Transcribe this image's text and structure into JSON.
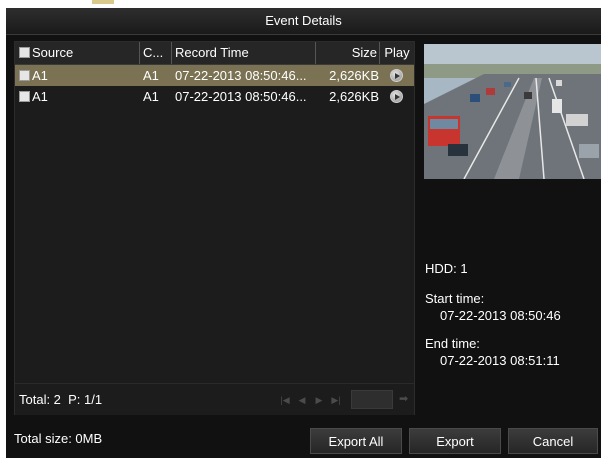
{
  "dialog": {
    "title": "Event Details"
  },
  "table": {
    "headers": {
      "source": "Source",
      "channel": "C...",
      "record_time": "Record Time",
      "size": "Size",
      "play": "Play"
    },
    "rows": [
      {
        "source": "A1",
        "channel": "A1",
        "record_time": "07-22-2013 08:50:46...",
        "size": "2,626KB",
        "selected": true
      },
      {
        "source": "A1",
        "channel": "A1",
        "record_time": "07-22-2013 08:50:46...",
        "size": "2,626KB",
        "selected": false
      }
    ]
  },
  "pager": {
    "summary": "Total: 2  P: 1/1"
  },
  "details": {
    "hdd": "HDD: 1",
    "start_label": "Start time:",
    "start_value": "07-22-2013 08:50:46",
    "end_label": "End time:",
    "end_value": "07-22-2013 08:51:11"
  },
  "footer": {
    "total_size": "Total size: 0MB",
    "export_all_label": "Export All",
    "export_label": "Export",
    "cancel_label": "Cancel"
  },
  "icons": {
    "play": "play-icon",
    "pager": [
      "first-page-icon",
      "prev-page-icon",
      "next-page-icon",
      "last-page-icon",
      "go-arrow-icon"
    ]
  },
  "colors": {
    "background": "#111111",
    "panel": "#1c1c1c",
    "selected_row": "#7a7252",
    "text": "#ffffff",
    "disabled": "#4b4b4b"
  }
}
